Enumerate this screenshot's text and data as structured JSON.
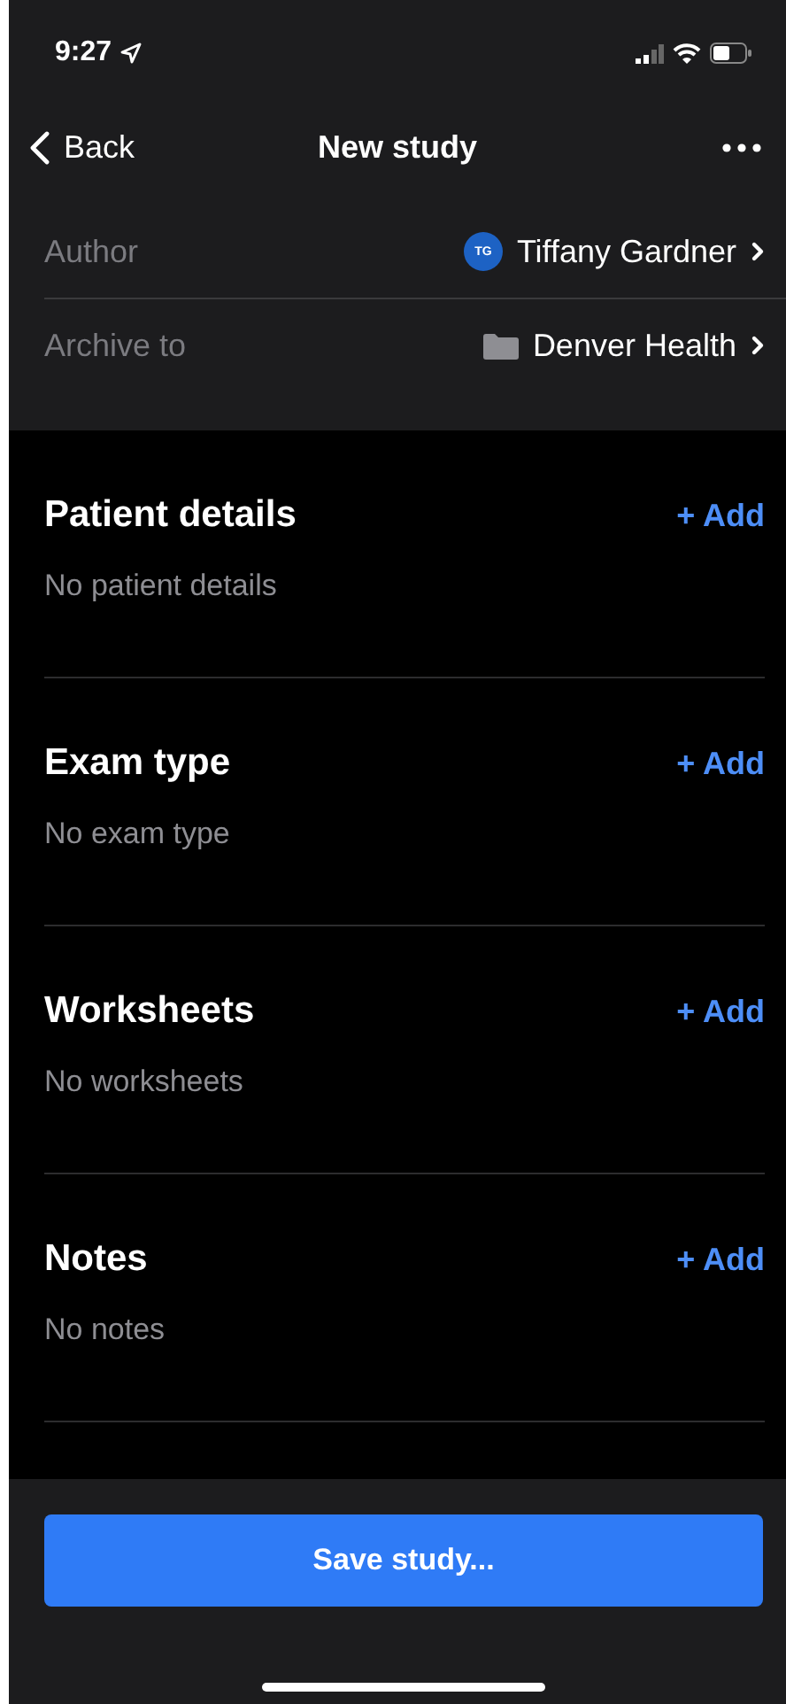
{
  "status_bar": {
    "time": "9:27"
  },
  "nav": {
    "back": "Back",
    "title": "New study"
  },
  "details": [
    {
      "kind": "author",
      "label": "Author",
      "value": "Tiffany Gardner",
      "initials": "TG"
    },
    {
      "kind": "folder",
      "label": "Archive to",
      "value": "Denver Health"
    }
  ],
  "sections": [
    {
      "title": "Patient details",
      "action": "+ Add",
      "empty": "No patient details"
    },
    {
      "title": "Exam type",
      "action": "+ Add",
      "empty": "No exam type"
    },
    {
      "title": "Worksheets",
      "action": "+ Add",
      "empty": "No worksheets"
    },
    {
      "title": "Notes",
      "action": "+ Add",
      "empty": "No notes"
    }
  ],
  "footer": {
    "button": "Save study..."
  }
}
